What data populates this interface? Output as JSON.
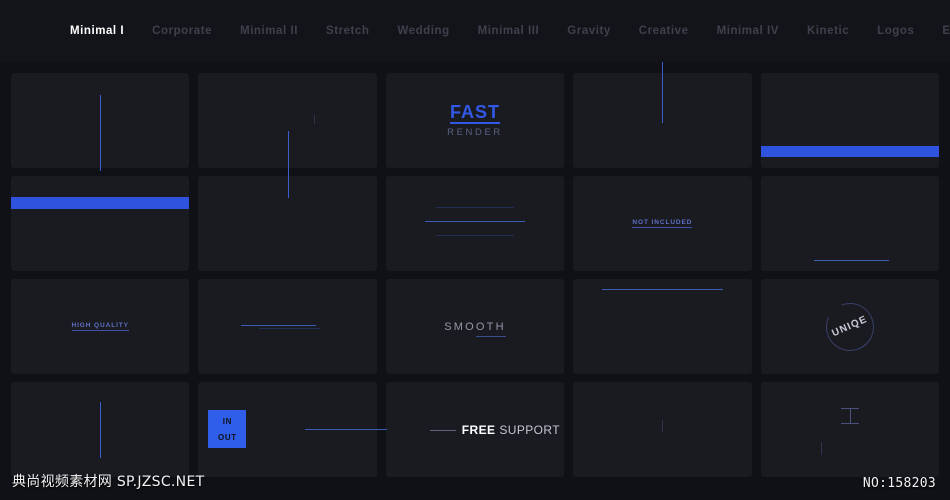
{
  "nav": {
    "tabs": [
      {
        "label": "Minimal I",
        "active": true
      },
      {
        "label": "Corporate",
        "active": false
      },
      {
        "label": "Minimal II",
        "active": false
      },
      {
        "label": "Stretch",
        "active": false
      },
      {
        "label": "Wedding",
        "active": false
      },
      {
        "label": "Minimal III",
        "active": false
      },
      {
        "label": "Gravity",
        "active": false
      },
      {
        "label": "Creative",
        "active": false
      },
      {
        "label": "Minimal IV",
        "active": false
      },
      {
        "label": "Kinetic",
        "active": false
      },
      {
        "label": "Logos",
        "active": false
      },
      {
        "label": "Elements",
        "active": false
      }
    ]
  },
  "cards": {
    "fast": {
      "title": "FAST",
      "subtitle": "RENDER"
    },
    "not_included": {
      "label": "NOT INCLUDED"
    },
    "high_quality": {
      "label": "HIGH QUALITY"
    },
    "smooth": {
      "label": "SMOOTH"
    },
    "unique": {
      "label": "UNIQE"
    },
    "inout": {
      "in_label": "IN",
      "out_label": "OUT"
    },
    "support": {
      "bold": "FREE",
      "rest": "SUPPORT"
    }
  },
  "watermark": {
    "left": "典尚视频素材网 SP.JZSC.NET",
    "right": "NO:158203"
  },
  "colors": {
    "page_bg": "#101116",
    "card_bg": "#191b21",
    "accent_blue": "#2f53df",
    "accent_blue_bright": "#3258e8",
    "muted_text": "#5b6382",
    "nav_inactive": "#3e414d"
  }
}
